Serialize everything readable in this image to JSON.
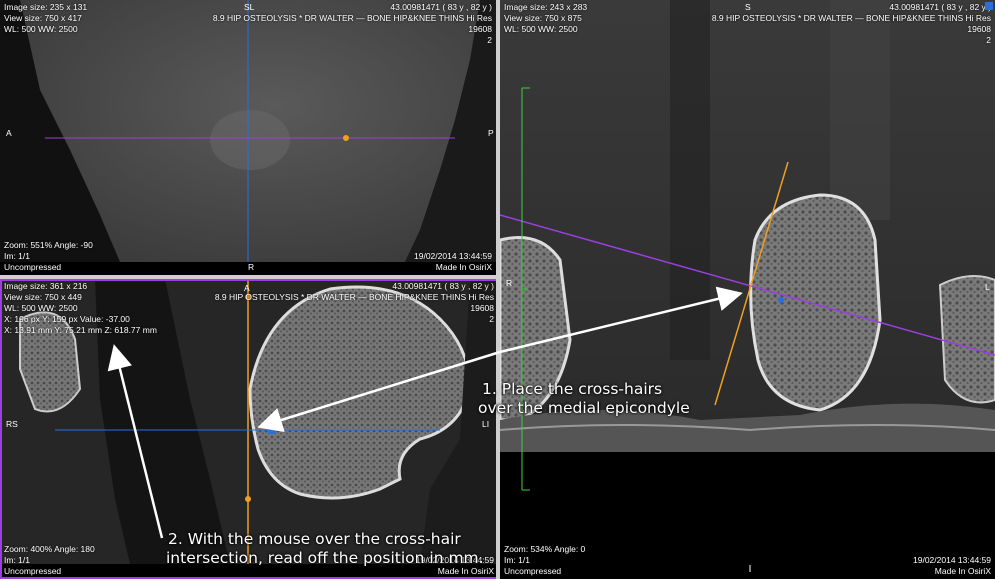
{
  "viewports": {
    "top_left": {
      "info_tl": [
        "Image size: 235 x 131",
        "View size: 750 x 417",
        "WL: 500 WW: 2500"
      ],
      "info_tr": [
        "43.00981471 ( 83 y , 82 y )",
        "8.9 HIP OSTEOLYSIS * DR WALTER — BONE HIP&KNEE THINS Hi Res",
        "19608",
        "2"
      ],
      "info_bl": [
        "Zoom: 551% Angle: -90",
        "Im: 1/1",
        "Uncompressed"
      ],
      "info_br": [
        "19/02/2014 13:44:59",
        "Made In OsiriX"
      ],
      "orient_top": "SL",
      "orient_left": "A",
      "orient_right": "P",
      "orient_bottom": "R"
    },
    "bottom_left": {
      "info_tl": [
        "Image size: 361 x 216",
        "View size: 750 x 449",
        "WL: 500 WW: 2500",
        "X: 196 px Y: 159 px Value: -37.00",
        "X: 13.91 mm Y: 75.21 mm Z: 618.77 mm"
      ],
      "info_tr": [
        "43.00981471 ( 83 y , 82 y )",
        "8.9 HIP OSTEOLYSIS * DR WALTER — BONE HIP&KNEE THINS Hi Res",
        "19608",
        "2"
      ],
      "info_bl": [
        "Zoom: 400% Angle: 180",
        "Im: 1/1",
        "Uncompressed"
      ],
      "info_br": [
        "19/02/2014 13:44:59",
        "Made In OsiriX"
      ],
      "orient_top": "A",
      "orient_left": "RS",
      "orient_right": "LI"
    },
    "right": {
      "info_tl": [
        "Image size: 243 x 283",
        "View size: 750 x 875",
        "WL: 500 WW: 2500"
      ],
      "info_tr": [
        "43.00981471 ( 83 y , 82 y )",
        "8.9 HIP OSTEOLYSIS * DR WALTER — BONE HIP&KNEE THINS Hi Res",
        "19608",
        "2"
      ],
      "info_bl": [
        "Zoom: 534% Angle: 0",
        "Im: 1/1",
        "Uncompressed"
      ],
      "info_br": [
        "19/02/2014 13:44:59",
        "Made In OsiriX"
      ],
      "orient_top": "S",
      "orient_left": "R",
      "orient_right": "L"
    }
  },
  "annotations": {
    "step1": [
      "1. Place the cross-hairs",
      "over the medial epicondyle"
    ],
    "step2": [
      "2. With the mouse over the cross-hair",
      "intersection, read off the position in mm."
    ]
  },
  "colors": {
    "selection_border": "#9b3fe0",
    "crosshair_blue": "#2a6fe0",
    "crosshair_orange": "#f0a020",
    "crosshair_purple": "#9b3fe0",
    "scale_green": "#3fcf3f"
  }
}
